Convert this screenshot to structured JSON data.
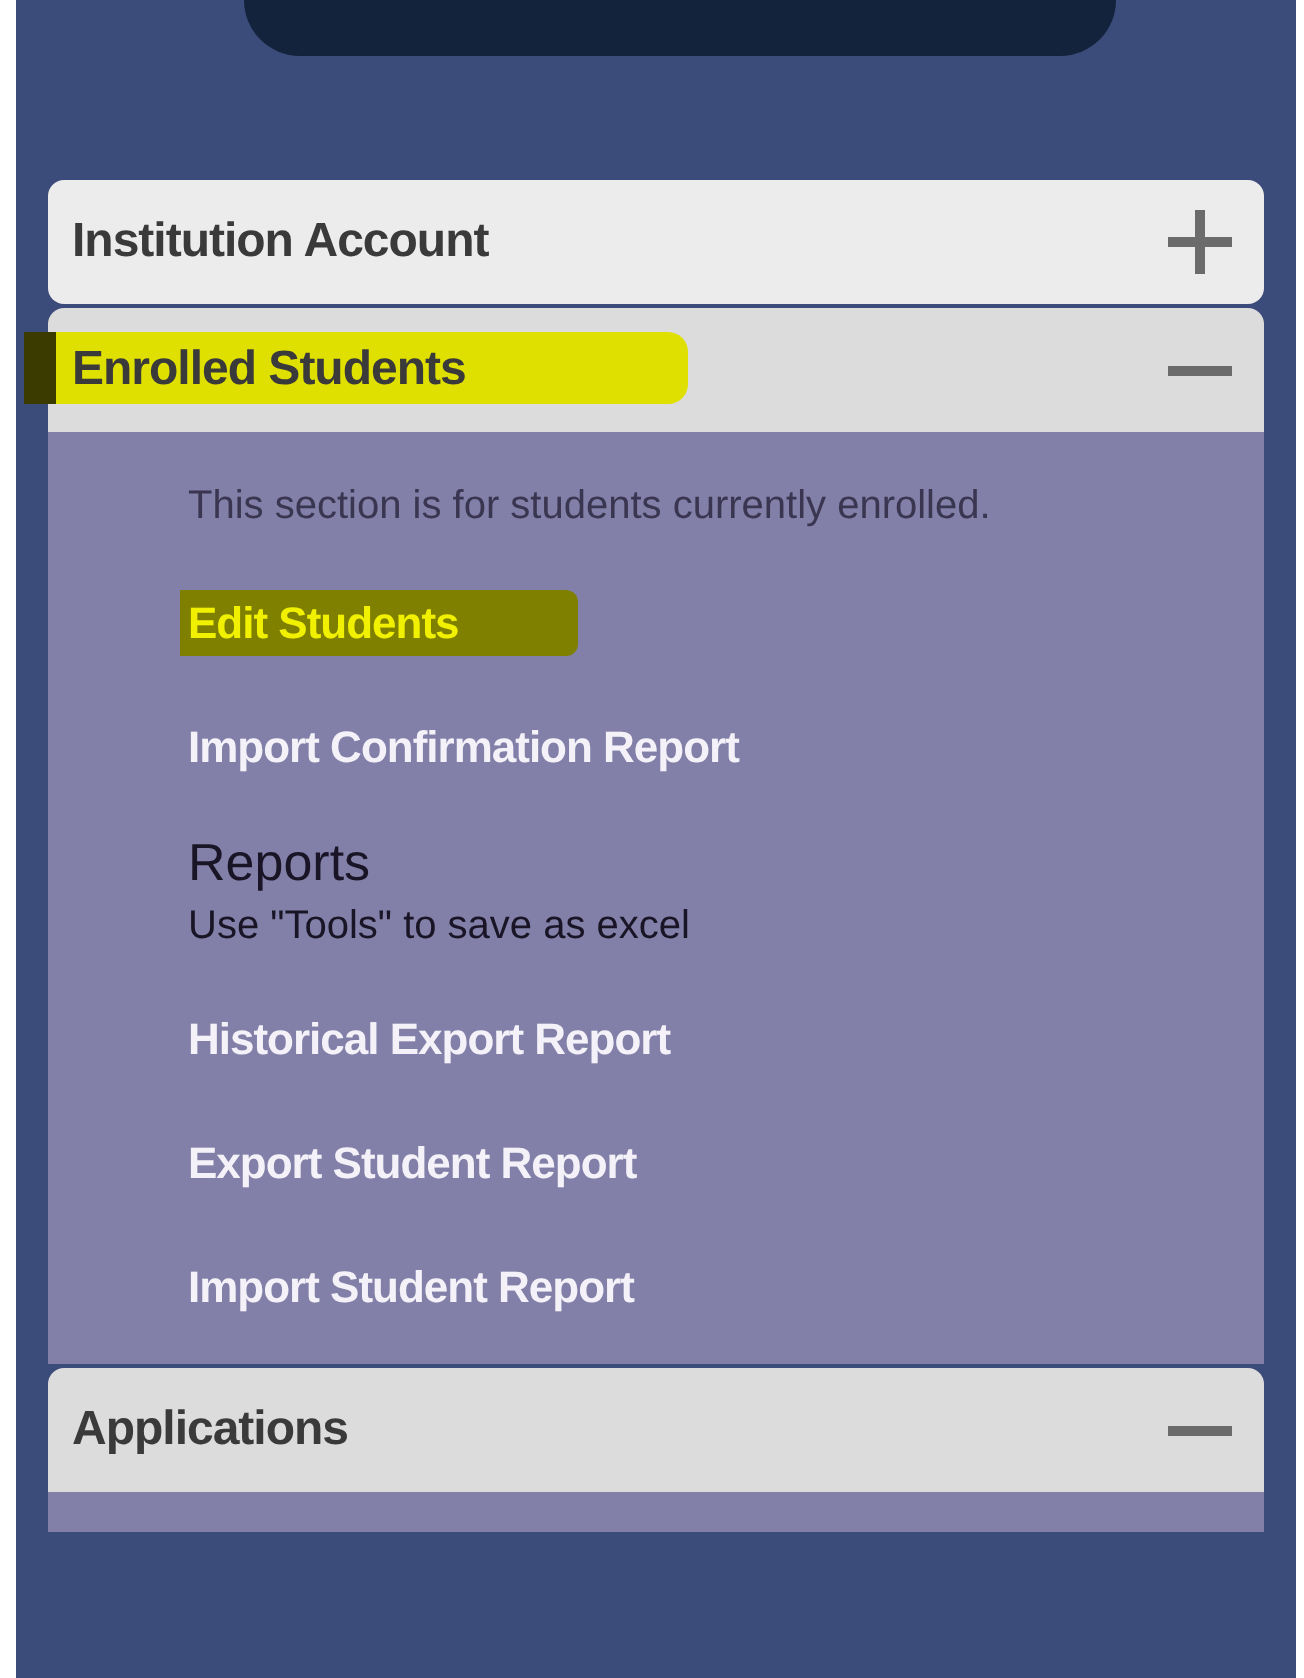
{
  "sections": [
    {
      "title": "Institution Account",
      "expanded": false,
      "highlighted": false
    },
    {
      "title": "Enrolled Students",
      "expanded": true,
      "highlighted": true,
      "items": [
        {
          "kind": "description",
          "text": "This section is for students currently enrolled."
        },
        {
          "kind": "link",
          "text": "Edit Students",
          "highlighted": true
        },
        {
          "kind": "link",
          "text": "Import Confirmation Report",
          "highlighted": false
        },
        {
          "kind": "heading",
          "text": "Reports",
          "subtitle": "Use \"Tools\" to save as excel"
        },
        {
          "kind": "link",
          "text": "Historical Export Report",
          "highlighted": false
        },
        {
          "kind": "link",
          "text": "Export Student Report",
          "highlighted": false
        },
        {
          "kind": "link",
          "text": "Import Student Report",
          "highlighted": false
        }
      ]
    },
    {
      "title": "Applications",
      "expanded": true,
      "highlighted": false
    }
  ]
}
